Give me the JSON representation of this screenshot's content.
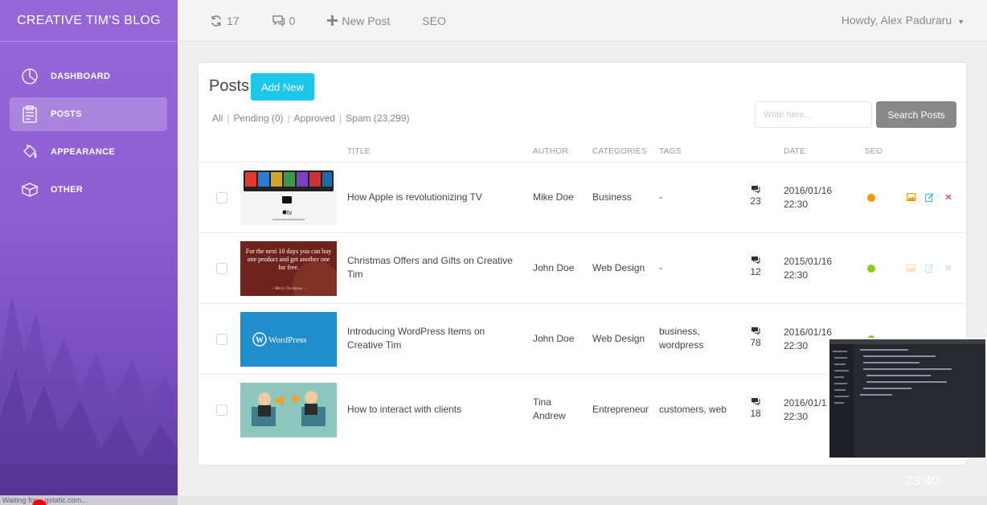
{
  "sidebar": {
    "brand": "CREATIVE TIM'S BLOG",
    "items": [
      {
        "label": "DASHBOARD",
        "icon": "pie-chart-icon"
      },
      {
        "label": "POSTS",
        "icon": "clipboard-icon",
        "active": true
      },
      {
        "label": "APPEARANCE",
        "icon": "paint-bucket-icon"
      },
      {
        "label": "OTHER",
        "icon": "box-icon"
      }
    ],
    "status_text": "Waiting for ...gstatic.com..."
  },
  "topbar": {
    "updates_count": "17",
    "comments_count": "0",
    "new_post_label": "New Post",
    "seo_label": "SEO",
    "user_greeting": "Howdy, Alex Paduraru"
  },
  "posts": {
    "title": "Posts",
    "add_new_label": "Add New",
    "filters": {
      "all": "All",
      "pending": "Pending (0)",
      "approved": "Approved",
      "spam": "Spam (23,299)"
    },
    "search_placeholder": "Write here...",
    "search_button": "Search Posts",
    "columns": {
      "title": "TITLE",
      "author": "AUTHOR",
      "categories": "CATEGORIES",
      "tags": "TAGS",
      "date": "DATE",
      "seo": "SEO"
    },
    "rows": [
      {
        "title": "How Apple is revolutionizing TV",
        "author": "Mike Doe",
        "category": "Business",
        "tags": "-",
        "comments": "23",
        "date": "2016/01/16",
        "time": "22:30",
        "seo_color": "#ff9500",
        "thumb_caption": "tv"
      },
      {
        "title": "Christmas Offers and Gifts on Creative Tim",
        "author": "John Doe",
        "category": "Web Design",
        "tags": "-",
        "comments": "12",
        "date": "2015/01/16",
        "time": "22:30",
        "seo_color": "#87cb16",
        "thumb_caption": "For the next 10 days you can buy one product and get another one for free."
      },
      {
        "title": "Introducing WordPress Items on Creative Tim",
        "author": "John Doe",
        "category": "Web Design",
        "tags": "business, wordpress",
        "comments": "78",
        "date": "2016/01/16",
        "time": "22:30",
        "seo_color": "#87cb16",
        "thumb_caption": "WordPress"
      },
      {
        "title": "How to interact with clients",
        "author": "Tina Andrew",
        "category": "Entrepreneur",
        "tags": "customers, web",
        "comments": "18",
        "date": "2016/01/1",
        "time": "22:30",
        "seo_color": "#87cb16",
        "thumb_caption": ""
      }
    ]
  },
  "video": {
    "timestamp": "23:40"
  },
  "colors": {
    "accent": "#1dc7ea",
    "sidebar": "#8e5fd3",
    "delete": "#ff4a55",
    "edit": "#1dc7ea",
    "image": "#ff9500"
  }
}
